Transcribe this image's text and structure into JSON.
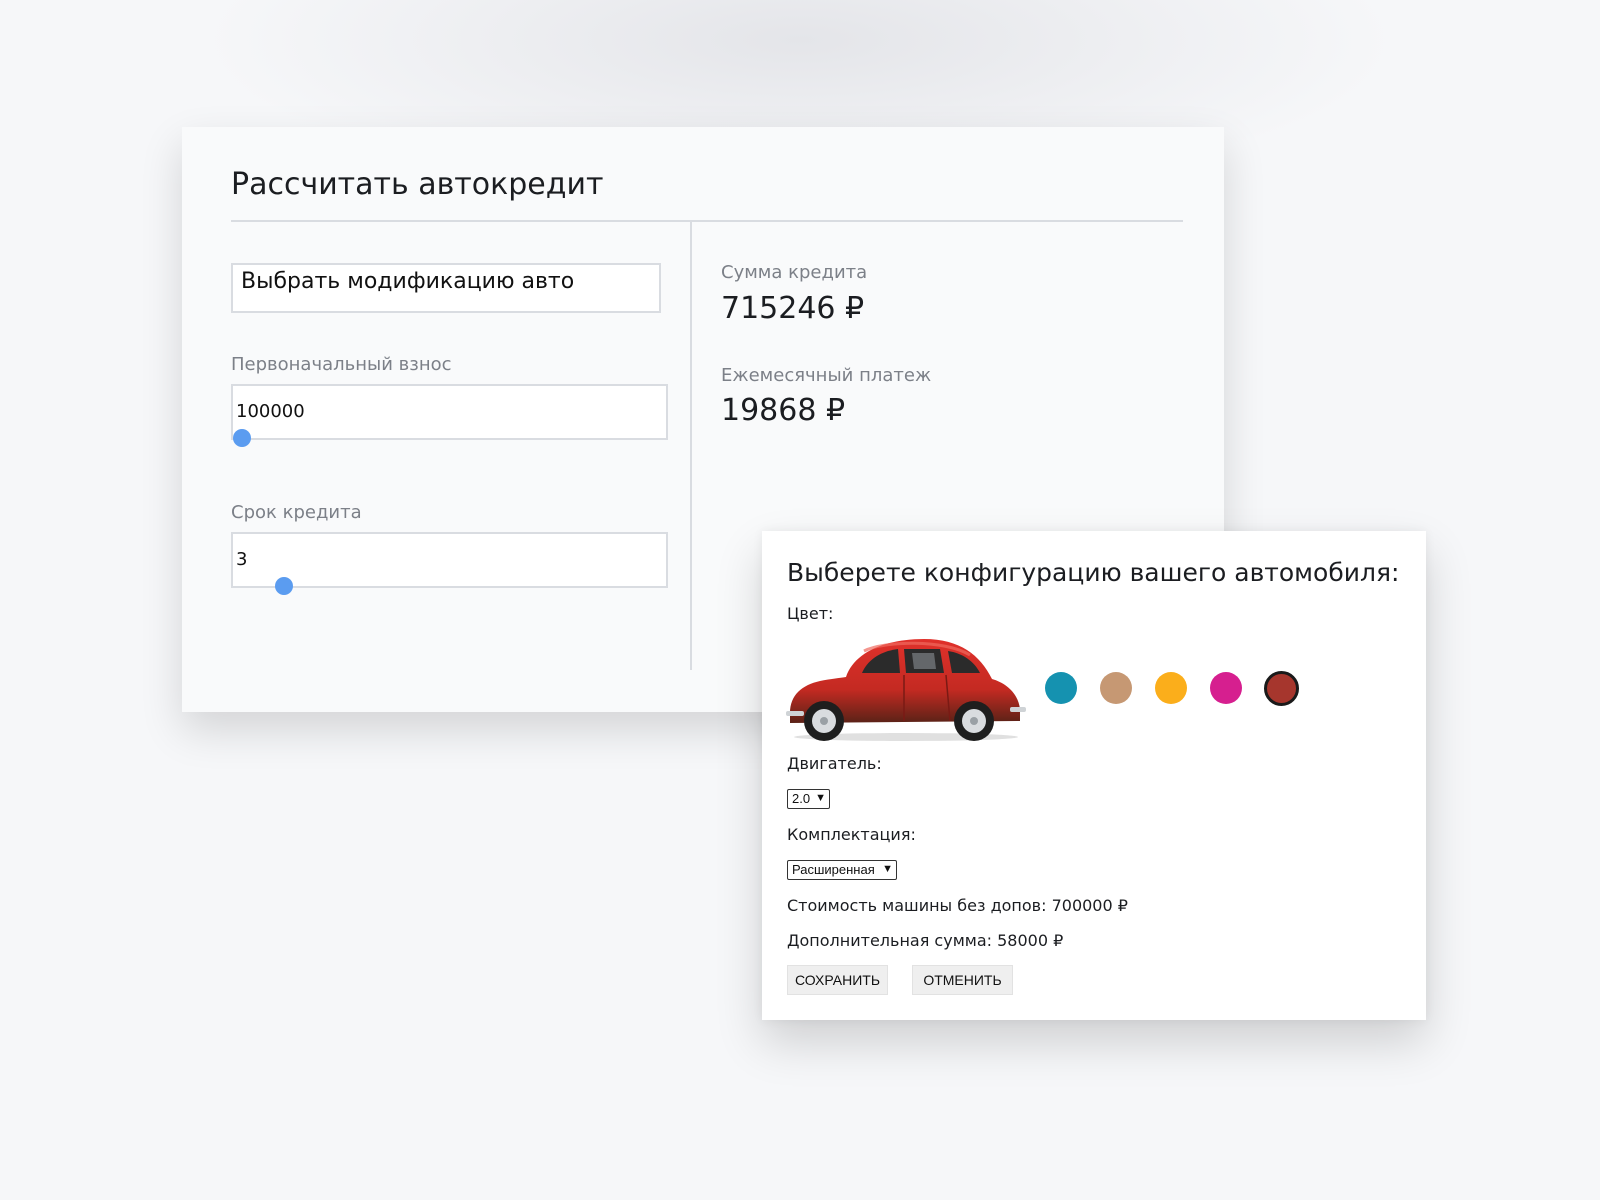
{
  "calculator": {
    "title": "Рассчитать автокредит",
    "modification_select": "Выбрать модификацию авто",
    "down_payment": {
      "label": "Первоначальный взнос",
      "value": "100000",
      "slider_fraction": 0.0
    },
    "term": {
      "label": "Срок кредита",
      "value": "3",
      "slider_fraction": 0.1
    },
    "loan_amount": {
      "label": "Сумма кредита",
      "value": "715246 ₽"
    },
    "monthly_payment": {
      "label": "Ежемесячный платеж",
      "value": "19868 ₽"
    }
  },
  "config": {
    "title": "Выберете конфигурацию вашего автомобиля:",
    "color_label": "Цвет:",
    "car_icon": "red-beetle-car",
    "colors": [
      "#1592b0",
      "#c69873",
      "#fbae1b",
      "#d61f8f",
      "#a6362d"
    ],
    "selected_color": "#a6362d",
    "engine_label": "Двигатель:",
    "engine_value": "2.0",
    "trim_label": "Комплектация:",
    "trim_value": "Расширенная",
    "base_price": "Стоимость машины без допов: 700000 ₽",
    "extra_sum": "Дополнительная сумма: 58000 ₽",
    "save_label": "СОХРАНИТЬ",
    "cancel_label": "ОТМЕНИТЬ"
  },
  "accent_color": "#5b9cf0"
}
